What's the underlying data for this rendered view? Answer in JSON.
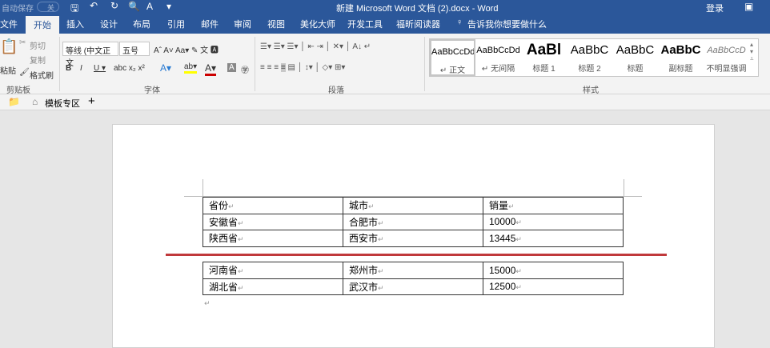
{
  "titlebar": {
    "autosave": "自动保存",
    "toggle": "关",
    "title": "新建 Microsoft Word 文档 (2).docx  -  Word",
    "login": "登录"
  },
  "tabs": [
    "文件",
    "开始",
    "插入",
    "设计",
    "布局",
    "引用",
    "邮件",
    "审阅",
    "视图",
    "美化大师",
    "开发工具",
    "福昕阅读器"
  ],
  "tell_me": "告诉我你想要做什么",
  "clipboard": {
    "paste": "粘贴",
    "cut": "剪切",
    "copy": "复制",
    "format_painter": "格式刷",
    "label": "剪贴板"
  },
  "font": {
    "name": "等线 (中文正文",
    "size": "五号",
    "label": "字体"
  },
  "paragraph": {
    "label": "段落"
  },
  "styles": {
    "label": "样式",
    "items": [
      {
        "preview": "AaBbCcDd",
        "name": "↵ 正文"
      },
      {
        "preview": "AaBbCcDd",
        "name": "↵ 无间隔"
      },
      {
        "preview": "AaBl",
        "name": "标题 1"
      },
      {
        "preview": "AaBbC",
        "name": "标题 2"
      },
      {
        "preview": "AaBbC",
        "name": "标题"
      },
      {
        "preview": "AaBbC",
        "name": "副标题"
      },
      {
        "preview": "AaBbCcD",
        "name": "不明显强调"
      }
    ]
  },
  "doctabs": {
    "template": "模板专区",
    "add": "+"
  },
  "table1": [
    [
      "省份",
      "城市",
      "销量"
    ],
    [
      "安徽省",
      "合肥市",
      "10000"
    ],
    [
      "陕西省",
      "西安市",
      "13445"
    ]
  ],
  "table2": [
    [
      "河南省",
      "郑州市",
      "15000"
    ],
    [
      "湖北省",
      "武汉市",
      "12500"
    ]
  ],
  "colors": {
    "accent": "#2b579a",
    "split_line": "#c0393b"
  }
}
